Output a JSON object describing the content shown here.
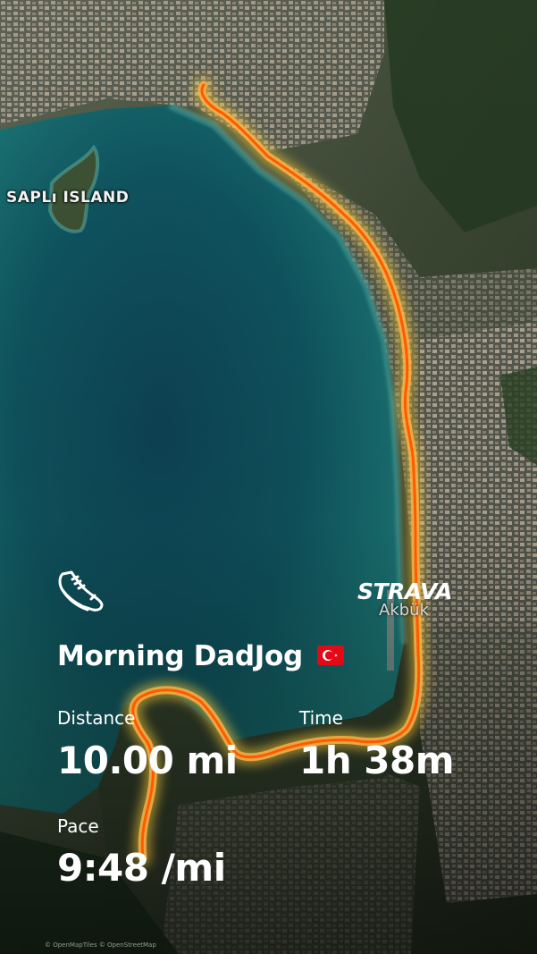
{
  "map": {
    "island_label": "SAPLı ISLAND",
    "place_label": "Akbük",
    "attribution": "© OpenMapTiles © OpenStreetMap",
    "colors": {
      "sea": "#0f4f5c",
      "land": "#2f3d2c",
      "route": "#ff6a00",
      "route_glow": "#ffd34a"
    }
  },
  "activity": {
    "icon": "running-shoe-icon",
    "title": "Morning DadJog",
    "flag": "turkey-flag-icon"
  },
  "brand": {
    "name": "STRAVA"
  },
  "stats": {
    "distance_label": "Distance",
    "distance_value": "10.00 mi",
    "time_label": "Time",
    "time_value": "1h 38m",
    "pace_label": "Pace",
    "pace_value": "9:48 /mi"
  }
}
